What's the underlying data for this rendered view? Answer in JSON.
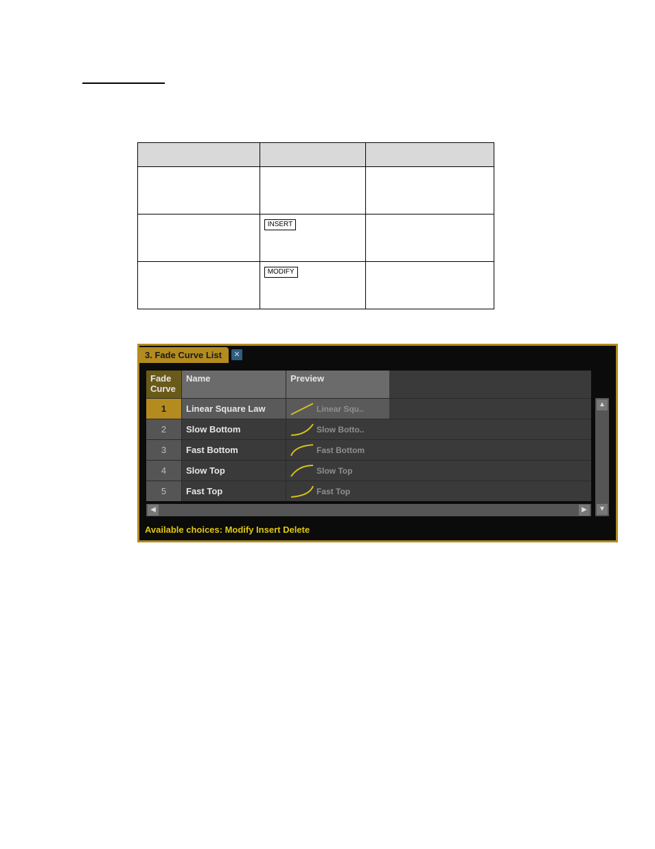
{
  "doc": {
    "heading": "",
    "intro": "",
    "table": {
      "headers": [
        "",
        "",
        ""
      ],
      "rows": [
        {
          "a": "",
          "b": "",
          "c": ""
        },
        {
          "a": "",
          "b_key": "INSERT",
          "b_rest": "",
          "c": ""
        },
        {
          "a": "",
          "b_key": "MODIFY",
          "b_rest": "",
          "c": ""
        }
      ]
    }
  },
  "panel": {
    "title": "3. Fade Curve List",
    "close_glyph": "✕",
    "columns": {
      "fade": "Fade Curve",
      "name": "Name",
      "preview": "Preview"
    },
    "rows": [
      {
        "idx": "1",
        "name": "Linear Square Law",
        "preview": "Linear Squ..",
        "curve": "linear",
        "selected": true
      },
      {
        "idx": "2",
        "name": "Slow Bottom",
        "preview": "Slow Botto..",
        "curve": "slowbottom",
        "selected": false
      },
      {
        "idx": "3",
        "name": "Fast Bottom",
        "preview": "Fast Bottom",
        "curve": "fastbottom",
        "selected": false
      },
      {
        "idx": "4",
        "name": "Slow Top",
        "preview": "Slow Top",
        "curve": "slowtop",
        "selected": false
      },
      {
        "idx": "5",
        "name": "Fast Top",
        "preview": "Fast Top",
        "curve": "fasttop",
        "selected": false
      }
    ],
    "status": "Available choices: Modify Insert Delete",
    "scroll": {
      "up": "▲",
      "down": "▼",
      "left": "◀",
      "right": "▶"
    }
  }
}
